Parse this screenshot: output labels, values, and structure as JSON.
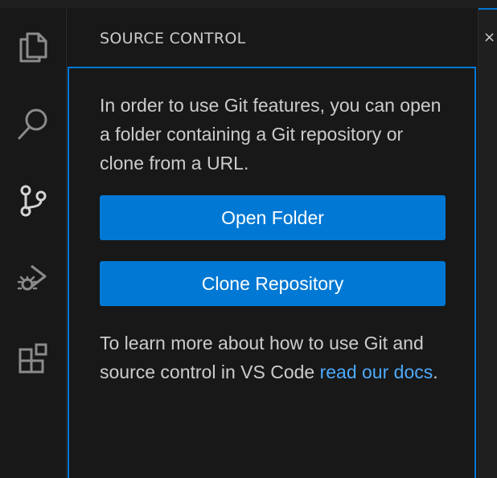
{
  "sidebar": {
    "title": "SOURCE CONTROL"
  },
  "activity_bar": {
    "items": [
      {
        "icon": "files-icon",
        "label": "Explorer"
      },
      {
        "icon": "search-icon",
        "label": "Search"
      },
      {
        "icon": "source-control-icon",
        "label": "Source Control"
      },
      {
        "icon": "run-debug-icon",
        "label": "Run and Debug"
      },
      {
        "icon": "extensions-icon",
        "label": "Extensions"
      }
    ]
  },
  "welcome": {
    "intro_text": "In order to use Git features, you can open a folder containing a Git repository or clone from a URL.",
    "open_folder_label": "Open Folder",
    "clone_repository_label": "Clone Repository",
    "learn_more_prefix": "To learn more about how to use Git and source control in VS Code ",
    "docs_link_text": "read our docs",
    "learn_more_suffix": "."
  },
  "editor": {
    "tab_close_glyph": "×"
  },
  "colors": {
    "accent": "#0078d4",
    "background": "#181818",
    "text": "#cccccc",
    "link": "#4daafc"
  }
}
